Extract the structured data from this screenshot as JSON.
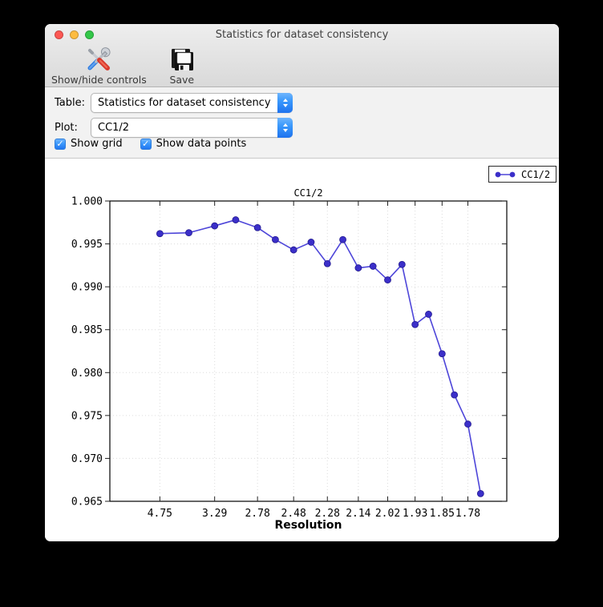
{
  "window": {
    "title": "Statistics for dataset consistency",
    "traffic_lights": {
      "close": "#fc5753",
      "minimize": "#fdbc40",
      "zoom": "#33c748"
    }
  },
  "toolbar": {
    "buttons": [
      {
        "label": "Show/hide controls",
        "icon": "tools-icon"
      },
      {
        "label": "Save",
        "icon": "floppy-disk-icon"
      }
    ]
  },
  "controls": {
    "accent_color": "#3b99fc",
    "table": {
      "label": "Table:",
      "value": "Statistics for dataset consistency"
    },
    "plot": {
      "label": "Plot:",
      "value": "CC1/2"
    },
    "checkboxes": [
      {
        "label": "Show grid",
        "checked": true
      },
      {
        "label": "Show data points",
        "checked": true
      }
    ]
  },
  "chart_data": {
    "type": "line",
    "title": "CC1/2",
    "xlabel": "Resolution",
    "ylim": [
      0.965,
      1.0
    ],
    "yticks": [
      "1.000",
      "0.995",
      "0.990",
      "0.985",
      "0.980",
      "0.975",
      "0.970",
      "0.965"
    ],
    "xticks": [
      {
        "label": "4.75",
        "frac": 0.126
      },
      {
        "label": "3.29",
        "frac": 0.264
      },
      {
        "label": "2.78",
        "frac": 0.372
      },
      {
        "label": "2.48",
        "frac": 0.463
      },
      {
        "label": "2.28",
        "frac": 0.548
      },
      {
        "label": "2.14",
        "frac": 0.626
      },
      {
        "label": "2.02",
        "frac": 0.7
      },
      {
        "label": "1.93",
        "frac": 0.769
      },
      {
        "label": "1.85",
        "frac": 0.837
      },
      {
        "label": "1.78",
        "frac": 0.902
      }
    ],
    "grid": true,
    "show_points": true,
    "legend": {
      "position": "top-right",
      "label": "CC1/2"
    },
    "series": [
      {
        "name": "CC1/2",
        "line_color": "#4e46d9",
        "marker_color": "#3b2fc9",
        "points": [
          {
            "frac": 0.126,
            "cc": 0.9962
          },
          {
            "frac": 0.199,
            "cc": 0.9963
          },
          {
            "frac": 0.264,
            "cc": 0.9971
          },
          {
            "frac": 0.317,
            "cc": 0.9978
          },
          {
            "frac": 0.372,
            "cc": 0.9969
          },
          {
            "frac": 0.417,
            "cc": 0.9955
          },
          {
            "frac": 0.463,
            "cc": 0.9943
          },
          {
            "frac": 0.507,
            "cc": 0.9952
          },
          {
            "frac": 0.548,
            "cc": 0.9927
          },
          {
            "frac": 0.587,
            "cc": 0.9955
          },
          {
            "frac": 0.626,
            "cc": 0.9922
          },
          {
            "frac": 0.663,
            "cc": 0.9924
          },
          {
            "frac": 0.7,
            "cc": 0.9908
          },
          {
            "frac": 0.736,
            "cc": 0.9926
          },
          {
            "frac": 0.769,
            "cc": 0.9856
          },
          {
            "frac": 0.803,
            "cc": 0.9868
          },
          {
            "frac": 0.837,
            "cc": 0.9822
          },
          {
            "frac": 0.868,
            "cc": 0.9774
          },
          {
            "frac": 0.902,
            "cc": 0.974
          },
          {
            "frac": 0.934,
            "cc": 0.9659
          }
        ]
      }
    ]
  }
}
